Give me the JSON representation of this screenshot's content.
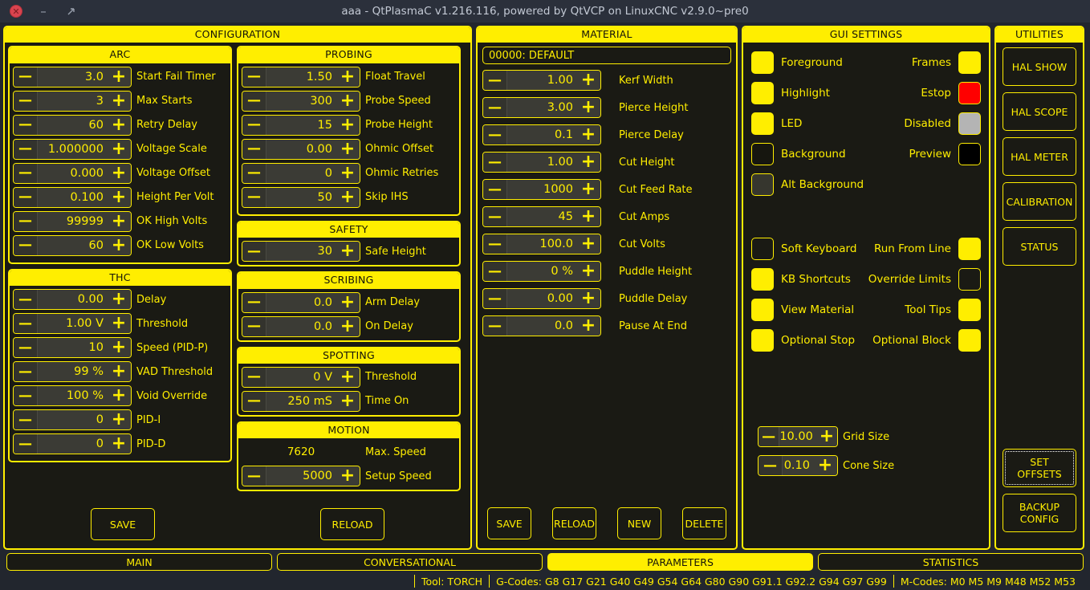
{
  "window": {
    "title": "aaa - QtPlasmaC v1.216.116, powered by QtVCP on LinuxCNC v2.9.0~pre0",
    "close_glyph": "✕",
    "minimize_glyph": "–"
  },
  "configuration": {
    "title": "CONFIGURATION",
    "arc": {
      "title": "ARC",
      "rows": [
        {
          "value": "3.0",
          "label": "Start Fail Timer"
        },
        {
          "value": "3",
          "label": "Max Starts"
        },
        {
          "value": "60",
          "label": "Retry Delay"
        },
        {
          "value": "1.000000",
          "label": "Voltage Scale"
        },
        {
          "value": "0.000",
          "label": "Voltage Offset"
        },
        {
          "value": "0.100",
          "label": "Height Per Volt"
        },
        {
          "value": "99999",
          "label": "OK High Volts"
        },
        {
          "value": "60",
          "label": "OK Low Volts"
        }
      ]
    },
    "thc": {
      "title": "THC",
      "rows": [
        {
          "value": "0.00",
          "label": "Delay"
        },
        {
          "value": "1.00 V",
          "label": "Threshold"
        },
        {
          "value": "10",
          "label": "Speed (PID-P)"
        },
        {
          "value": "99 %",
          "label": "VAD Threshold"
        },
        {
          "value": "100 %",
          "label": "Void Override"
        },
        {
          "value": "0",
          "label": "PID-I"
        },
        {
          "value": "0",
          "label": "PID-D"
        }
      ]
    },
    "probing": {
      "title": "PROBING",
      "rows": [
        {
          "value": "1.50",
          "label": "Float Travel"
        },
        {
          "value": "300",
          "label": "Probe Speed"
        },
        {
          "value": "15",
          "label": "Probe Height"
        },
        {
          "value": "0.00",
          "label": "Ohmic Offset"
        },
        {
          "value": "0",
          "label": "Ohmic Retries"
        },
        {
          "value": "50",
          "label": "Skip IHS"
        }
      ]
    },
    "safety": {
      "title": "SAFETY",
      "rows": [
        {
          "value": "30",
          "label": "Safe Height"
        }
      ]
    },
    "scribing": {
      "title": "SCRIBING",
      "rows": [
        {
          "value": "0.0",
          "label": "Arm Delay"
        },
        {
          "value": "0.0",
          "label": "On Delay"
        }
      ]
    },
    "spotting": {
      "title": "SPOTTING",
      "rows": [
        {
          "value": "0 V",
          "label": "Threshold"
        },
        {
          "value": "250 mS",
          "label": "Time On"
        }
      ]
    },
    "motion": {
      "title": "MOTION",
      "max_speed_value": "7620",
      "max_speed_label": "Max. Speed",
      "rows": [
        {
          "value": "5000",
          "label": "Setup Speed"
        }
      ]
    },
    "save_label": "SAVE",
    "reload_label": "RELOAD"
  },
  "material": {
    "title": "MATERIAL",
    "selected": "00000: DEFAULT",
    "rows": [
      {
        "value": "1.00",
        "label": "Kerf Width"
      },
      {
        "value": "3.00",
        "label": "Pierce Height"
      },
      {
        "value": "0.1",
        "label": "Pierce Delay"
      },
      {
        "value": "1.00",
        "label": "Cut Height"
      },
      {
        "value": "1000",
        "label": "Cut Feed Rate"
      },
      {
        "value": "45",
        "label": "Cut Amps"
      },
      {
        "value": "100.0",
        "label": "Cut Volts"
      },
      {
        "value": "0 %",
        "label": "Puddle Height"
      },
      {
        "value": "0.00",
        "label": "Puddle Delay"
      },
      {
        "value": "0.0",
        "label": "Pause At End"
      }
    ],
    "buttons": [
      {
        "label": "SAVE"
      },
      {
        "label": "RELOAD"
      },
      {
        "label": "NEW"
      },
      {
        "label": "DELETE"
      }
    ]
  },
  "gui_settings": {
    "title": "GUI SETTINGS",
    "colors": [
      {
        "label": "Foreground",
        "color": "#ffee00",
        "side": "left"
      },
      {
        "label": "Frames",
        "color": "#ffee00",
        "side": "right"
      },
      {
        "label": "Highlight",
        "color": "#ffee00",
        "side": "left"
      },
      {
        "label": "Estop",
        "color": "#ff0000",
        "side": "right"
      },
      {
        "label": "LED",
        "color": "#ffee00",
        "side": "left"
      },
      {
        "label": "Disabled",
        "color": "#b4b4b4",
        "side": "right"
      },
      {
        "label": "Background",
        "color": "#16160f",
        "side": "left"
      },
      {
        "label": "Preview",
        "color": "#000000",
        "side": "right"
      },
      {
        "label": "Alt Background",
        "color": "#36362e",
        "side": "left"
      }
    ],
    "color_rows": [
      {
        "left_label": "Foreground",
        "left_color": "#ffee00",
        "right_label": "Frames",
        "right_color": "#ffee00"
      },
      {
        "left_label": "Highlight",
        "left_color": "#ffee00",
        "right_label": "Estop",
        "right_color": "#ff0000"
      },
      {
        "left_label": "LED",
        "left_color": "#ffee00",
        "right_label": "Disabled",
        "right_color": "#b4b4b4"
      },
      {
        "left_label": "Background",
        "left_color": "#16160f",
        "right_label": "Preview",
        "right_color": "#000000"
      },
      {
        "left_label": "Alt Background",
        "left_color": "#36362e",
        "right_label": "",
        "right_color": null
      }
    ],
    "checkbox_rows": [
      {
        "left_label": "Soft Keyboard",
        "left_checked": false,
        "right_label": "Run From Line",
        "right_checked": true
      },
      {
        "left_label": "KB Shortcuts",
        "left_checked": true,
        "right_label": "Override Limits",
        "right_checked": false
      },
      {
        "left_label": "View Material",
        "left_checked": true,
        "right_label": "Tool Tips",
        "right_checked": true
      },
      {
        "left_label": "Optional Stop",
        "left_checked": true,
        "right_label": "Optional Block",
        "right_checked": true
      }
    ],
    "spins": [
      {
        "value": "10.00",
        "label": "Grid Size"
      },
      {
        "value": "0.10",
        "label": "Cone Size"
      }
    ]
  },
  "utilities": {
    "title": "UTILITIES",
    "buttons": [
      {
        "label": "HAL SHOW"
      },
      {
        "label": "HAL SCOPE"
      },
      {
        "label": "HAL METER"
      },
      {
        "label": "CALIBRATION"
      },
      {
        "label": "STATUS"
      }
    ],
    "bottom_buttons": [
      {
        "label": "SET\nOFFSETS",
        "line1": "SET",
        "line2": "OFFSETS",
        "focused": true
      },
      {
        "label": "BACKUP\nCONFIG",
        "line1": "BACKUP",
        "line2": "CONFIG",
        "focused": false
      }
    ]
  },
  "tabs": [
    {
      "label": "MAIN",
      "active": false
    },
    {
      "label": "CONVERSATIONAL",
      "active": false
    },
    {
      "label": "PARAMETERS",
      "active": true
    },
    {
      "label": "STATISTICS",
      "active": false
    }
  ],
  "statusbar": {
    "tool": "Tool: TORCH",
    "gcodes": "G-Codes: G8 G17 G21 G40 G49 G54 G64 G80 G90 G91.1 G92.2 G94 G97 G99",
    "mcodes": "M-Codes: M0 M5 M9 M48 M52 M53"
  }
}
